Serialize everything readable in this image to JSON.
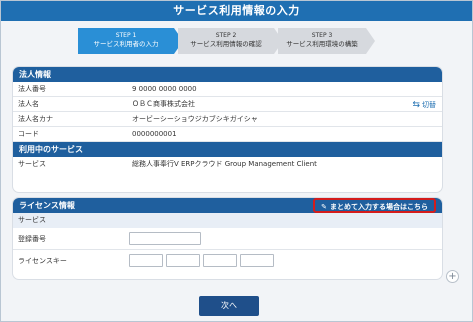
{
  "title": "サービス利用情報の入力",
  "steps": [
    {
      "num": "STEP 1",
      "label": "サービス利用者の入力"
    },
    {
      "num": "STEP 2",
      "label": "サービス利用情報の確認"
    },
    {
      "num": "STEP 3",
      "label": "サービス利用環境の構築"
    }
  ],
  "corporate": {
    "header": "法人情報",
    "rows": [
      {
        "key": "法人番号",
        "value": "9 0000  0000 0000"
      },
      {
        "key": "法人名",
        "value": "ＯＢＣ商事株式会社"
      },
      {
        "key": "法人名カナ",
        "value": "オービーシーショウジカブシキガイシャ"
      },
      {
        "key": "コード",
        "value": "0000000001"
      }
    ],
    "switch_label": "切替"
  },
  "service": {
    "header": "利用中のサービス",
    "key": "サービス",
    "value": "総務人事奉行V ERPクラウド Group Management Client"
  },
  "license": {
    "header": "ライセンス情報",
    "bulk_button": "まとめて入力する場合はこちら",
    "service_label": "サービス",
    "reg_label": "登録番号",
    "key_label": "ライセンスキー"
  },
  "next_button": "次へ",
  "colors": {
    "brand": "#1f6fb2",
    "section_header": "#1f5f9e",
    "active_step": "#2a8fd6",
    "highlight_border": "#d41c1c"
  }
}
